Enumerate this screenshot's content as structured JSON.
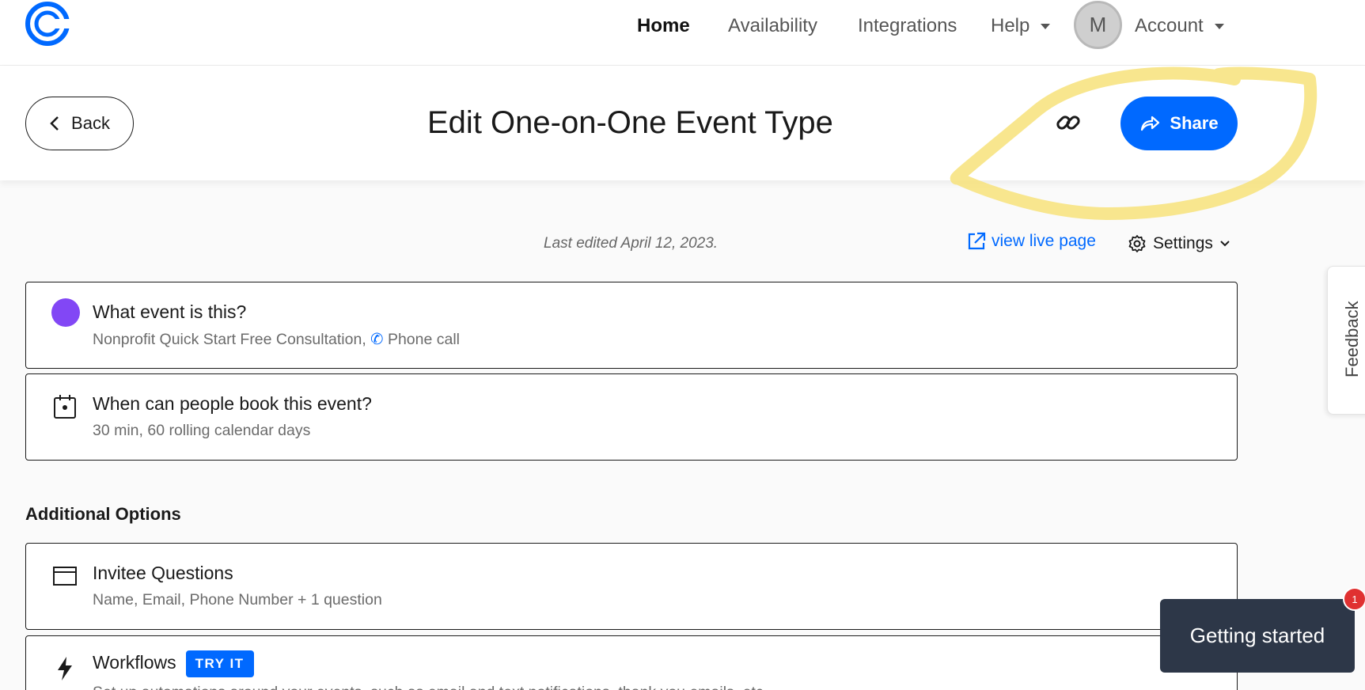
{
  "nav": {
    "home": "Home",
    "availability": "Availability",
    "integrations": "Integrations",
    "help": "Help",
    "avatar_initial": "M",
    "account": "Account"
  },
  "header": {
    "back_label": "Back",
    "title": "Edit One-on-One Event Type",
    "share_label": "Share"
  },
  "meta": {
    "last_edited": "Last edited April 12, 2023.",
    "view_live": "view live page",
    "settings": "Settings"
  },
  "cards": [
    {
      "title": "What event is this?",
      "subtitle_prefix": "Nonprofit Quick Start Free Consultation,",
      "subtitle_phone": "Phone call",
      "icon": "purple-dot-icon",
      "color": "#8247f5"
    },
    {
      "title": "When can people book this event?",
      "subtitle": "30 min, 60 rolling calendar days",
      "icon": "calendar-icon"
    }
  ],
  "additional": {
    "heading": "Additional Options",
    "invitee_title": "Invitee Questions",
    "invitee_sub": "Name, Email, Phone Number + 1 question",
    "workflows_title": "Workflows",
    "workflows_badge": "TRY IT",
    "workflows_sub": "Set up automations around your events, such as email and text notifications, thank you emails, etc."
  },
  "feedback_label": "Feedback",
  "getting_started": {
    "label": "Getting started",
    "badge_count": "1"
  },
  "colors": {
    "accent": "#0069ff",
    "highlight": "#f7e27a",
    "badge": "#e03131"
  }
}
